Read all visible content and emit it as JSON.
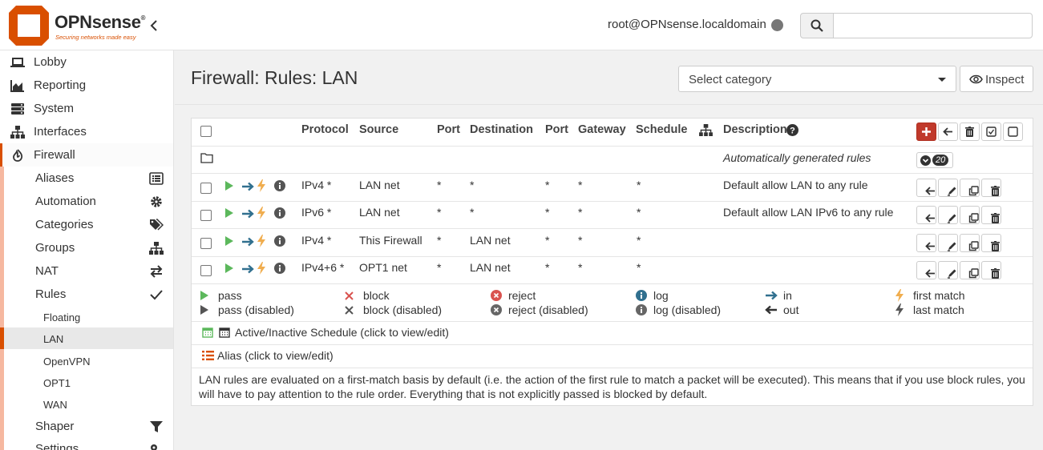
{
  "header": {
    "brand": "OPNsense",
    "tagline": "Securing networks made easy",
    "user": "root@OPNsense.localdomain",
    "search_placeholder": ""
  },
  "sidebar": {
    "top": [
      {
        "label": "Lobby",
        "icon": "laptop-icon"
      },
      {
        "label": "Reporting",
        "icon": "area-chart-icon"
      },
      {
        "label": "System",
        "icon": "server-icon"
      },
      {
        "label": "Interfaces",
        "icon": "sitemap-icon"
      },
      {
        "label": "Firewall",
        "icon": "fire-icon"
      }
    ],
    "firewall_sub": [
      {
        "label": "Aliases",
        "icon": "list-alt-icon"
      },
      {
        "label": "Automation",
        "icon": "gear-icon"
      },
      {
        "label": "Categories",
        "icon": "tags-icon"
      },
      {
        "label": "Groups",
        "icon": "sitemap-icon"
      },
      {
        "label": "NAT",
        "icon": "exchange-icon"
      },
      {
        "label": "Rules",
        "icon": "check-icon"
      }
    ],
    "rules_sub": [
      "Floating",
      "LAN",
      "OpenVPN",
      "OPT1",
      "WAN"
    ],
    "after": [
      {
        "label": "Shaper",
        "icon": "filter-icon"
      },
      {
        "label": "Settings",
        "icon": "cogs-icon"
      }
    ]
  },
  "page": {
    "title": "Firewall: Rules: LAN",
    "category_placeholder": "Select category",
    "inspect_label": "Inspect"
  },
  "table": {
    "headers": {
      "protocol": "Protocol",
      "source": "Source",
      "port": "Port",
      "destination": "Destination",
      "dport": "Port",
      "gateway": "Gateway",
      "schedule": "Schedule",
      "description": "Description"
    },
    "auto_rules_label": "Automatically generated rules",
    "auto_rules_count": "20",
    "rows": [
      {
        "protocol": "IPv4 *",
        "source": "LAN net",
        "port": "*",
        "destination": "*",
        "dport": "*",
        "gateway": "*",
        "schedule": "*",
        "description": "Default allow LAN to any rule"
      },
      {
        "protocol": "IPv6 *",
        "source": "LAN net",
        "port": "*",
        "destination": "*",
        "dport": "*",
        "gateway": "*",
        "schedule": "*",
        "description": "Default allow LAN IPv6 to any rule"
      },
      {
        "protocol": "IPv4 *",
        "source": "This Firewall",
        "port": "*",
        "destination": "LAN net",
        "dport": "*",
        "gateway": "*",
        "schedule": "*",
        "description": ""
      },
      {
        "protocol": "IPv4+6 *",
        "source": "OPT1 net",
        "port": "*",
        "destination": "LAN net",
        "dport": "*",
        "gateway": "*",
        "schedule": "*",
        "description": ""
      }
    ]
  },
  "legend": {
    "pass": "pass",
    "pass_disabled": "pass (disabled)",
    "block": "block",
    "block_disabled": "block (disabled)",
    "reject": "reject",
    "reject_disabled": "reject (disabled)",
    "log": "log",
    "log_disabled": "log (disabled)",
    "in": "in",
    "out": "out",
    "first_match": "first match",
    "last_match": "last match",
    "schedule": "Active/Inactive Schedule (click to view/edit)",
    "alias": "Alias (click to view/edit)"
  },
  "note": "LAN rules are evaluated on a first-match basis by default (i.e. the action of the first rule to match a packet will be executed). This means that if you use block rules, you will have to pay attention to the rule order. Everything that is not explicitly passed is blocked by default.",
  "colors": {
    "brand": "#d94f00",
    "pass": "#5cb85c",
    "in": "#31708f",
    "first_match": "#f0ad4e",
    "reject": "#d9534f",
    "add_button": "#c0392b"
  }
}
